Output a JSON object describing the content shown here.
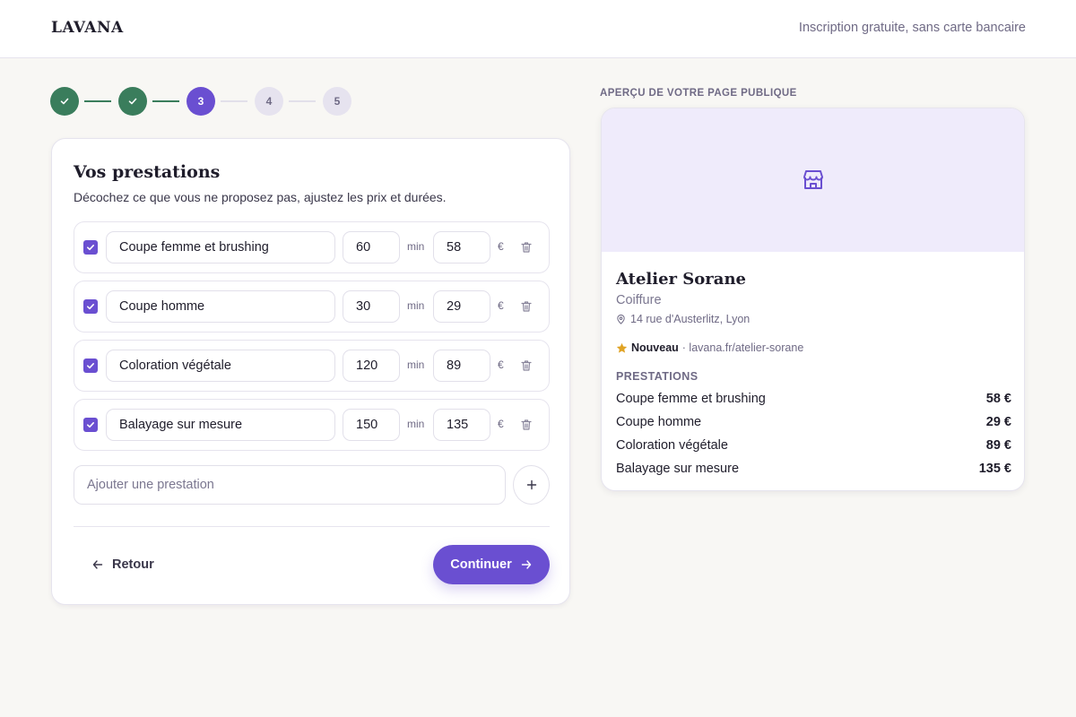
{
  "header": {
    "logo": "LAVANA",
    "tagline": "Inscription gratuite, sans carte bancaire"
  },
  "stepper": {
    "steps": [
      {
        "label": "",
        "state": "done"
      },
      {
        "label": "",
        "state": "done"
      },
      {
        "label": "3",
        "state": "active"
      },
      {
        "label": "4",
        "state": "todo"
      },
      {
        "label": "5",
        "state": "todo"
      }
    ]
  },
  "form": {
    "title": "Vos prestations",
    "subtitle": "Décochez ce que vous ne proposez pas, ajustez les prix et durées.",
    "duration_unit": "min",
    "currency_unit": "€",
    "services": [
      {
        "checked": true,
        "name": "Coupe femme et brushing",
        "duration": "60",
        "price": "58"
      },
      {
        "checked": true,
        "name": "Coupe homme",
        "duration": "30",
        "price": "29"
      },
      {
        "checked": true,
        "name": "Coloration végétale",
        "duration": "120",
        "price": "89"
      },
      {
        "checked": true,
        "name": "Balayage sur mesure",
        "duration": "150",
        "price": "135"
      }
    ],
    "add_placeholder": "Ajouter une prestation",
    "back_label": "Retour",
    "continue_label": "Continuer"
  },
  "preview": {
    "label": "APERÇU DE VOTRE PAGE PUBLIQUE",
    "business_name": "Atelier Sorane",
    "category": "Coiffure",
    "address": "14 rue d'Austerlitz, Lyon",
    "badge": "Nouveau",
    "url": "· lavana.fr/atelier-sorane",
    "services_title": "PRESTATIONS",
    "services": [
      {
        "name": "Coupe femme et brushing",
        "price": "58 €"
      },
      {
        "name": "Coupe homme",
        "price": "29 €"
      },
      {
        "name": "Coloration végétale",
        "price": "89 €"
      },
      {
        "name": "Balayage sur mesure",
        "price": "135 €"
      }
    ]
  },
  "colors": {
    "accent": "#6a4fd1",
    "done": "#3a7d5c",
    "cover": "#efebfb",
    "star": "#e0a325"
  },
  "icons": {
    "done_step": "check-icon",
    "trash": "trash-icon",
    "add": "plus-icon",
    "back": "arrow-left-icon",
    "continue": "arrow-right-icon",
    "cover": "store-icon",
    "address": "map-pin-icon",
    "badge": "star-icon"
  }
}
